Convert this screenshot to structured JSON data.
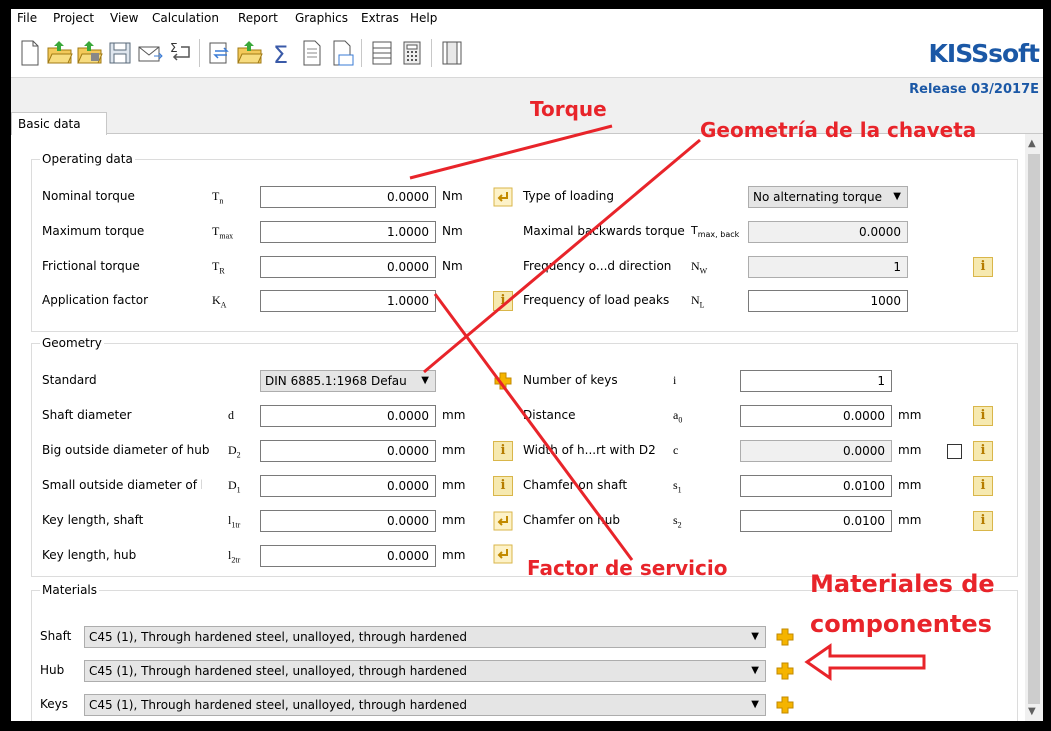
{
  "menu": [
    "File",
    "Project",
    "View",
    "Calculation",
    "Report",
    "Graphics",
    "Extras",
    "Help"
  ],
  "toolbar_icons": [
    "new-file-icon",
    "open-folder-icon",
    "open-example-icon",
    "save-icon",
    "email-icon",
    "sum-undo-icon",
    "convert-icon",
    "open-folder-alt-icon",
    "calculate-sum-icon",
    "report-icon",
    "report-view-icon",
    "report-list-icon",
    "calculator-icon",
    "module-specifics-icon"
  ],
  "logo": "KISSsoft",
  "release": "Release 03/2017E",
  "tab": "Basic data",
  "operating": {
    "title": "Operating data",
    "rows": [
      {
        "label": "Nominal torque",
        "sym": "T",
        "sub": "n",
        "value": "0.0000",
        "unit": "Nm"
      },
      {
        "label": "Maximum torque",
        "sym": "T",
        "sub": "max",
        "value": "1.0000",
        "unit": "Nm"
      },
      {
        "label": "Frictional torque",
        "sym": "T",
        "sub": "R",
        "value": "0.0000",
        "unit": "Nm"
      },
      {
        "label": "Application factor",
        "sym": "K",
        "sub": "A",
        "value": "1.0000",
        "unit": ""
      }
    ],
    "right": [
      {
        "label": "Type of loading",
        "sym": "",
        "sub": "",
        "value": "No alternating torque"
      },
      {
        "label": "Maximal backwards torque",
        "sym": "T",
        "sub": "max, back",
        "value": "0.0000"
      },
      {
        "label": "Frequency o...d direction",
        "sym": "N",
        "sub": "W",
        "value": "1"
      },
      {
        "label": "Frequency of load peaks",
        "sym": "N",
        "sub": "L",
        "value": "1000"
      }
    ]
  },
  "geometry": {
    "title": "Geometry",
    "rows": [
      {
        "label": "Standard",
        "sym": "",
        "sub": "",
        "value": "DIN 6885.1:1968 Defau",
        "unit": ""
      },
      {
        "label": "Shaft diameter",
        "sym": "d",
        "sub": "",
        "value": "0.0000",
        "unit": "mm"
      },
      {
        "label": "Big outside diameter of hub",
        "sym": "D",
        "sub": "2",
        "value": "0.0000",
        "unit": "mm"
      },
      {
        "label": "Small outside diameter of hul",
        "sym": "D",
        "sub": "1",
        "value": "0.0000",
        "unit": "mm"
      },
      {
        "label": "Key length, shaft",
        "sym": "l",
        "sub": "1tr",
        "value": "0.0000",
        "unit": "mm"
      },
      {
        "label": "Key length, hub",
        "sym": "l",
        "sub": "2tr",
        "value": "0.0000",
        "unit": "mm"
      }
    ],
    "right": [
      {
        "label": "Number of keys",
        "sym": "i",
        "sub": "",
        "value": "1",
        "unit": ""
      },
      {
        "label": "Distance",
        "sym": "a",
        "sub": "0",
        "value": "0.0000",
        "unit": "mm"
      },
      {
        "label": "Width of h...rt with D2",
        "sym": "c",
        "sub": "",
        "value": "0.0000",
        "unit": "mm"
      },
      {
        "label": "Chamfer on shaft",
        "sym": "s",
        "sub": "1",
        "value": "0.0100",
        "unit": "mm"
      },
      {
        "label": "Chamfer on hub",
        "sym": "s",
        "sub": "2",
        "value": "0.0100",
        "unit": "mm"
      }
    ]
  },
  "materials": {
    "title": "Materials",
    "rows": [
      {
        "label": "Shaft",
        "value": "C45 (1), Through hardened steel, unalloyed, through hardened"
      },
      {
        "label": "Hub",
        "value": "C45 (1), Through hardened steel, unalloyed, through hardened"
      },
      {
        "label": "Keys",
        "value": "C45 (1), Through hardened steel, unalloyed, through hardened"
      }
    ]
  },
  "annotations": {
    "torque": "Torque",
    "geometry": "Geometría de la chaveta",
    "service": "Factor de servicio",
    "materials_1": "Materiales de",
    "materials_2": "componentes",
    "color": "#e8242a"
  }
}
